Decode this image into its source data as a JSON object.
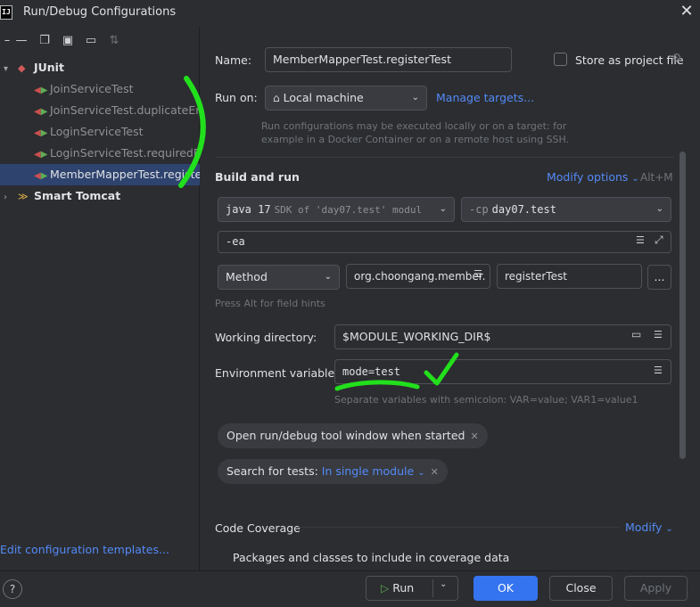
{
  "window": {
    "title": "Run/Debug Configurations",
    "logo_text": "IJ",
    "close_glyph": "✕"
  },
  "toolbar": {
    "icons": [
      "minus-icon",
      "copy-icon",
      "save-icon",
      "folder-add-icon",
      "move-icon",
      "sort-icon"
    ]
  },
  "tree": {
    "groups": [
      {
        "label": "JUnit",
        "expanded": true,
        "items": [
          {
            "label": "JoinServiceTest"
          },
          {
            "label": "JoinServiceTest.duplicateEmailT"
          },
          {
            "label": "LoginServiceTest"
          },
          {
            "label": "LoginServiceTest.requiredFieldT"
          },
          {
            "label": "MemberMapperTest.registerTest",
            "selected": true
          }
        ]
      },
      {
        "label": "Smart Tomcat",
        "expanded": false,
        "items": []
      }
    ],
    "edit_templates_link": "Edit configuration templates..."
  },
  "form": {
    "name_label": "Name:",
    "name_value": "MemberMapperTest.registerTest",
    "store_as_project_file": "Store as project file",
    "run_on_label": "Run on:",
    "run_on_value": "Local machine",
    "manage_targets": "Manage targets...",
    "run_on_hint_1": "Run configurations may be executed locally or on a target: for",
    "run_on_hint_2": "example in a Docker Container or on a remote host using SSH.",
    "build_and_run": "Build and run",
    "modify_options": "Modify options",
    "modify_options_shortcut": "Alt+M",
    "jdk_name": "java 17",
    "jdk_detail": "SDK of 'day07.test' modul",
    "cp_prefix": "-cp",
    "cp_value": "day07.test",
    "vm_options": "-ea",
    "test_kind": "Method",
    "class_value": "org.choongang.member.",
    "method_value": "registerTest",
    "more_button": "...",
    "field_hint": "Press Alt for field hints",
    "working_dir_label": "Working directory:",
    "working_dir_value": "$MODULE_WORKING_DIR$",
    "env_label": "Environment variables:",
    "env_value": "mode=test",
    "env_hint": "Separate variables with semicolon: VAR=value; VAR1=value1",
    "chip_open_tool_window": "Open run/debug tool window when started",
    "chip_search_prefix": "Search for tests:",
    "chip_search_value": "In single module",
    "code_coverage": "Code Coverage",
    "modify": "Modify",
    "packages_label": "Packages and classes to include in coverage data"
  },
  "buttons": {
    "help": "?",
    "run": "Run",
    "ok": "OK",
    "close": "Close",
    "apply": "Apply"
  },
  "colors": {
    "accent": "#3574f0",
    "link": "#548af7",
    "selection": "#2e436e",
    "annotation_green": "#22e01c"
  }
}
